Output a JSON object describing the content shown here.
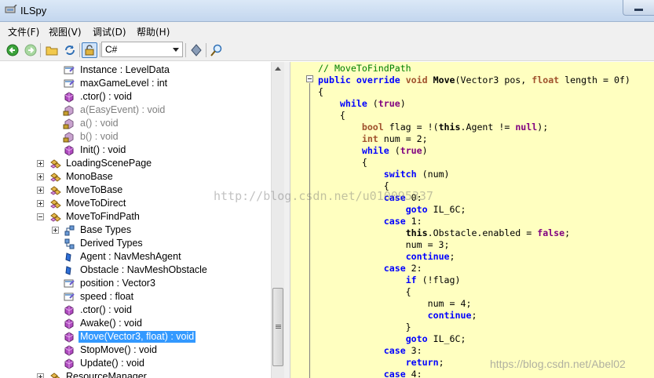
{
  "window": {
    "title": "ILSpy"
  },
  "menu": [
    "文件(F)",
    "视图(V)",
    "调试(D)",
    "帮助(H)"
  ],
  "toolbar": {
    "language": "C#",
    "icons": [
      "back-icon",
      "forward-icon",
      "open-folder-icon",
      "refresh-icon",
      "show-internals-icon",
      "assembly-icon",
      "search-icon"
    ]
  },
  "tree": [
    {
      "label": "Instance : LevelData",
      "icon": "property-icon"
    },
    {
      "label": "maxGameLevel : int",
      "icon": "property-icon"
    },
    {
      "label": ".ctor() : void",
      "icon": "method-icon"
    },
    {
      "label": "a(EasyEvent) : void",
      "icon": "private-method-icon"
    },
    {
      "label": "a() : void",
      "icon": "private-method-icon"
    },
    {
      "label": "b() : void",
      "icon": "private-method-icon"
    },
    {
      "label": "Init() : void",
      "icon": "method-icon"
    },
    {
      "label": "LoadingScenePage",
      "icon": "class-icon"
    },
    {
      "label": "MonoBase",
      "icon": "class-icon"
    },
    {
      "label": "MoveToBase",
      "icon": "class-icon"
    },
    {
      "label": "MoveToDirect",
      "icon": "class-icon"
    },
    {
      "label": "MoveToFindPath",
      "icon": "class-icon"
    },
    {
      "label": "Base Types",
      "icon": "base-types-icon"
    },
    {
      "label": "Derived Types",
      "icon": "derived-types-icon"
    },
    {
      "label": "Agent : NavMeshAgent",
      "icon": "field-icon"
    },
    {
      "label": "Obstacle : NavMeshObstacle",
      "icon": "field-icon"
    },
    {
      "label": "position : Vector3",
      "icon": "property-icon"
    },
    {
      "label": "speed : float",
      "icon": "property-icon"
    },
    {
      "label": ".ctor() : void",
      "icon": "method-icon"
    },
    {
      "label": "Awake() : void",
      "icon": "method-icon"
    },
    {
      "label": "Move(Vector3, float) : void",
      "icon": "method-icon"
    },
    {
      "label": "StopMove() : void",
      "icon": "method-icon"
    },
    {
      "label": "Update() : void",
      "icon": "method-icon"
    },
    {
      "label": "ResourceManager",
      "icon": "class-icon"
    }
  ],
  "code": {
    "comment": "// MoveToFindPath",
    "lines": [
      "// MoveToFindPath",
      "public override void Move(Vector3 pos, float length = 0f)",
      "{",
      "    while (true)",
      "    {",
      "        bool flag = !(this.Agent != null);",
      "        int num = 2;",
      "        while (true)",
      "        {",
      "            switch (num)",
      "            {",
      "            case 0:",
      "                goto IL_6C;",
      "            case 1:",
      "                this.Obstacle.enabled = false;",
      "                num = 3;",
      "                continue;",
      "            case 2:",
      "                if (!flag)",
      "                {",
      "                    num = 4;",
      "                    continue;",
      "                }",
      "                goto IL_6C;",
      "            case 3:",
      "                return;",
      "            case 4:"
    ]
  },
  "watermarks": [
    "http://blog.csdn.net/u010095337",
    "https://blog.csdn.net/Abel02"
  ]
}
